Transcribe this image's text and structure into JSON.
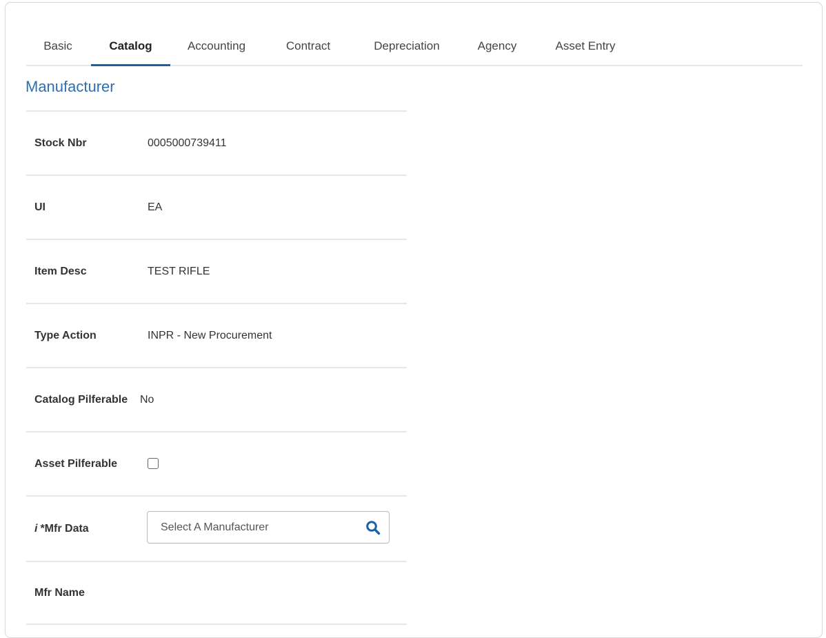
{
  "tabs": [
    {
      "label": "Basic",
      "active": false
    },
    {
      "label": "Catalog",
      "active": true
    },
    {
      "label": "Accounting",
      "active": false
    },
    {
      "label": "Contract",
      "active": false
    },
    {
      "label": "Depreciation",
      "active": false
    },
    {
      "label": "Agency",
      "active": false
    },
    {
      "label": "Asset Entry",
      "active": false
    }
  ],
  "section": {
    "title": "Manufacturer"
  },
  "fields": {
    "stock_nbr": {
      "label": "Stock Nbr",
      "value": "0005000739411"
    },
    "ui": {
      "label": "UI",
      "value": "EA"
    },
    "item_desc": {
      "label": "Item Desc",
      "value": "TEST RIFLE"
    },
    "type_action": {
      "label": "Type Action",
      "value": "INPR - New Procurement"
    },
    "catalog_pilferable": {
      "label": "Catalog Pilferable",
      "value": "No"
    },
    "asset_pilferable": {
      "label": "Asset Pilferable",
      "checked": false
    },
    "mfr_data": {
      "info": "i",
      "label": "*Mfr Data",
      "placeholder": "Select A Manufacturer",
      "value": ""
    },
    "mfr_name": {
      "label": "Mfr Name",
      "value": ""
    }
  },
  "icons": {
    "search": "search-icon",
    "search_color": "#1c5fa8"
  },
  "colors": {
    "accent": "#1c5fa8",
    "section_title": "#2f6fad"
  }
}
